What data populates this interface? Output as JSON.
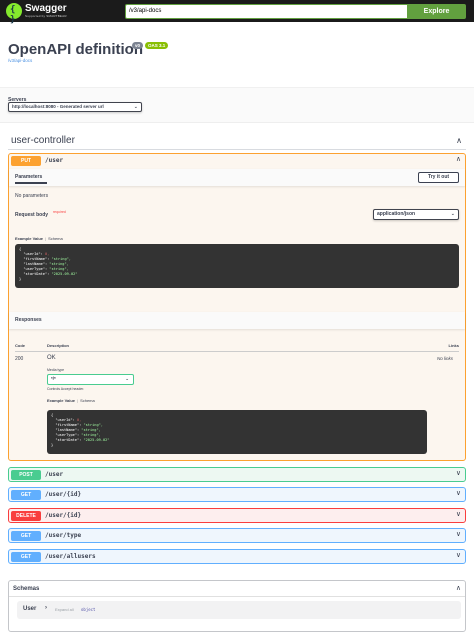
{
  "topbar": {
    "logo_text": "Swagger",
    "logo_sub": "Supported by SMARTBEAR",
    "logo_mark": "{ }",
    "url_value": "/v3/api-docs",
    "explore_label": "Explore"
  },
  "info": {
    "title": "OpenAPI definition",
    "version_badge": "v0",
    "oas_badge": "OAS 3.1",
    "spec_link": "/v3/api-docs"
  },
  "servers": {
    "label": "Servers",
    "selected": "http://localhost:8080 - Generated server url"
  },
  "tag": {
    "name": "user-controller",
    "chevron": "∧"
  },
  "put_op": {
    "method": "PUT",
    "path": "/user",
    "chevron": "∧",
    "parameters_tab": "Parameters",
    "try_label": "Try it out",
    "no_params": "No parameters",
    "request_body_label": "Request body",
    "required_label": "required",
    "content_type": "application/json",
    "example_tab": "Example Value",
    "schema_tab": "Schema",
    "responses_title": "Responses",
    "resp_col_code": "Code",
    "resp_col_desc": "Description",
    "resp_col_links": "Links",
    "resp_code": "200",
    "resp_desc": "OK",
    "resp_links": "No links",
    "media_type_label": "Media type",
    "media_type_value": "*/*",
    "controls_text": "Controls Accept header.",
    "resp_example_tab": "Example Value",
    "resp_schema_tab": "Schema"
  },
  "example_json": {
    "open": "{",
    "lines": [
      {
        "key": "\"userId\"",
        "val": "0",
        "num": true
      },
      {
        "key": "\"firstName\"",
        "val": "\"string\"",
        "num": false
      },
      {
        "key": "\"lastName\"",
        "val": "\"string\"",
        "num": false
      },
      {
        "key": "\"userType\"",
        "val": "\"string\"",
        "num": false
      },
      {
        "key": "\"startDate\"",
        "val": "\"2025-09-02\"",
        "num": false
      }
    ],
    "close": "}"
  },
  "operations": [
    {
      "method": "POST",
      "path": "/user",
      "chevron": "∨"
    },
    {
      "method": "GET",
      "path": "/user/{id}",
      "chevron": "∨"
    },
    {
      "method": "DELETE",
      "path": "/user/{id}",
      "chevron": "∨"
    },
    {
      "method": "GET",
      "path": "/user/type",
      "chevron": "∨"
    },
    {
      "method": "GET",
      "path": "/user/allusers",
      "chevron": "∨"
    }
  ],
  "schemas": {
    "title": "Schemas",
    "chevron": "∧",
    "model_name": "User",
    "model_arrow": "›",
    "expand_text": "Expand all",
    "model_type": "object"
  },
  "colors": {
    "put": "#fca130",
    "post": "#49cc90",
    "get": "#61affe",
    "delete": "#f93e3e",
    "explore": "#62a03f"
  }
}
